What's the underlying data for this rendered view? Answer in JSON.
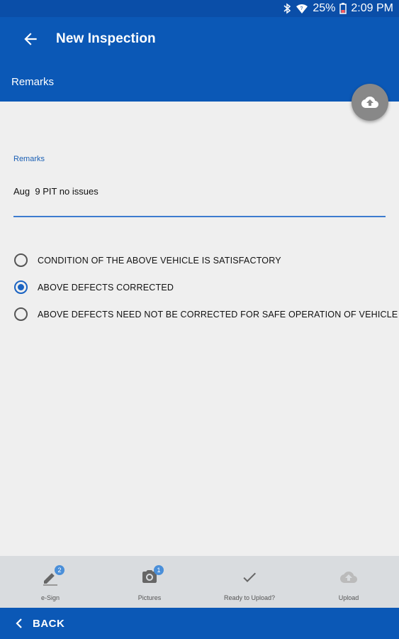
{
  "status_bar": {
    "battery": "25%",
    "time": "2:09 PM",
    "icons": [
      "bluetooth-icon",
      "wifi-icon",
      "battery-icon"
    ]
  },
  "app_bar": {
    "title": "New Inspection"
  },
  "section": {
    "title": "Remarks"
  },
  "remarks": {
    "label": "Remarks",
    "value": "Aug  9 PIT no issues"
  },
  "options": [
    {
      "label": "CONDITION OF THE ABOVE VEHICLE IS SATISFACTORY",
      "selected": false
    },
    {
      "label": "ABOVE DEFECTS CORRECTED",
      "selected": true
    },
    {
      "label": "ABOVE DEFECTS NEED NOT BE CORRECTED FOR SAFE OPERATION OF VEHICLE",
      "selected": false
    }
  ],
  "toolbar": {
    "esign": {
      "label": "e-Sign",
      "badge": "2"
    },
    "pictures": {
      "label": "Pictures",
      "badge": "1"
    },
    "ready": {
      "label": "Ready to Upload?"
    },
    "upload": {
      "label": "Upload"
    }
  },
  "footer": {
    "back_label": "BACK"
  },
  "colors": {
    "primary": "#0b58b6",
    "accent": "#1a63c2",
    "toolbar_bg": "#d9dcdf",
    "fab": "#888888"
  }
}
